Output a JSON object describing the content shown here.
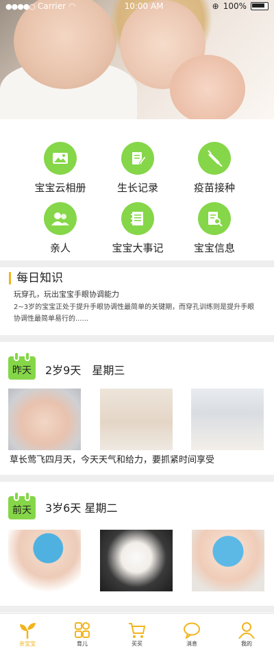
{
  "status_bar": {
    "carrier": "Carrier",
    "time": "10:00 AM",
    "battery": "100%"
  },
  "features": [
    {
      "label": "宝宝云相册",
      "icon": "image-icon"
    },
    {
      "label": "生长记录",
      "icon": "notepad-pen-icon"
    },
    {
      "label": "疫苗接种",
      "icon": "syringe-icon"
    },
    {
      "label": "亲人",
      "icon": "people-icon"
    },
    {
      "label": "宝宝大事记",
      "icon": "notebook-icon"
    },
    {
      "label": "宝宝信息",
      "icon": "document-search-icon"
    }
  ],
  "knowledge": {
    "title": "每日知识",
    "subtitle": "玩穿孔，玩出宝宝手眼协调能力",
    "body": "2~3岁的宝宝正处于提升手眼协调性最简单的关键期，而穿孔训练则是提升手眼协调性最简单易行的......"
  },
  "days": [
    {
      "badge": "昨天",
      "header": "2岁9天　星期三",
      "caption": "草长莺飞四月天，今天天气和给力，要抓紧时间享受"
    },
    {
      "badge": "前天",
      "header": "3岁6天  星期二"
    }
  ],
  "tabs": [
    {
      "label": "亲宝宝",
      "icon": "sprout-icon",
      "active": true
    },
    {
      "label": "育儿",
      "icon": "grid-icon",
      "active": false
    },
    {
      "label": "买买",
      "icon": "cart-icon",
      "active": false
    },
    {
      "label": "消息",
      "icon": "chat-bubble-icon",
      "active": false
    },
    {
      "label": "我的",
      "icon": "user-icon",
      "active": false
    }
  ],
  "colors": {
    "accent_green": "#85d648",
    "accent_yellow": "#f2b41b",
    "separator": "#eeeeee"
  }
}
